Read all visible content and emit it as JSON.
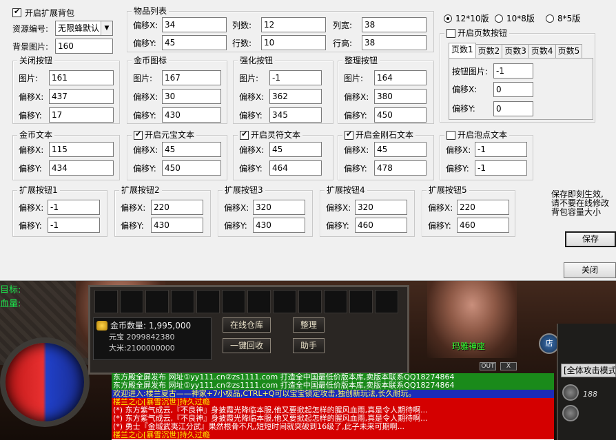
{
  "dialog": {
    "enable_bag": {
      "label": "开启扩展背包",
      "checked": true
    },
    "resource_label": "资源编号:",
    "resource_value": "无限蜂默认",
    "bg_label": "背景图片:",
    "bg_value": "160",
    "items": {
      "title": "物品列表",
      "off_x_label": "偏移X:",
      "off_x": "34",
      "off_y_label": "偏移Y:",
      "off_y": "45",
      "cols_label": "列数:",
      "cols": "12",
      "rows_label": "行数:",
      "rows": "10",
      "colw_label": "列宽:",
      "colw": "38",
      "rowh_label": "行高:",
      "rowh": "38"
    },
    "layouts": [
      {
        "label": "12*10版",
        "selected": true
      },
      {
        "label": "10*8版",
        "selected": false
      },
      {
        "label": "8*5版",
        "selected": false
      }
    ],
    "page_btn": {
      "title": "开启页数按钮",
      "checked": false,
      "tabs": [
        "页数1",
        "页数2",
        "页数3",
        "页数4",
        "页数5"
      ],
      "img_label": "按钮图片:",
      "img": "-1",
      "x_label": "偏移X:",
      "x": "0",
      "y_label": "偏移Y:",
      "y": "0"
    },
    "close_btn": {
      "title": "关闭按钮",
      "img_label": "图片:",
      "img": "161",
      "x_label": "偏移X:",
      "x": "437",
      "y_label": "偏移Y:",
      "y": "17"
    },
    "gold_icon": {
      "title": "金币图标",
      "img_label": "图片:",
      "img": "167",
      "x_label": "偏移X:",
      "x": "30",
      "y_label": "偏移Y:",
      "y": "430"
    },
    "enhance_btn": {
      "title": "强化按钮",
      "img_label": "图片:",
      "img": "-1",
      "x_label": "偏移X:",
      "x": "362",
      "y_label": "偏移Y:",
      "y": "345"
    },
    "sort_btn": {
      "title": "整理按钮",
      "img_label": "图片:",
      "img": "164",
      "x_label": "偏移X:",
      "x": "380",
      "y_label": "偏移Y:",
      "y": "450"
    },
    "gold_text": {
      "title": "金币文本",
      "x_label": "偏移X:",
      "x": "115",
      "y_label": "偏移Y:",
      "y": "434"
    },
    "yuanbao_text": {
      "title": "开启元宝文本",
      "checked": true,
      "x_label": "偏移X:",
      "x": "45",
      "y_label": "偏移Y:",
      "y": "450"
    },
    "lingfu_text": {
      "title": "开启灵符文本",
      "checked": true,
      "x_label": "偏移X:",
      "x": "45",
      "y_label": "偏移Y:",
      "y": "464"
    },
    "diamond_text": {
      "title": "开启金刚石文本",
      "checked": true,
      "x_label": "偏移X:",
      "x": "45",
      "y_label": "偏移Y:",
      "y": "478"
    },
    "bubble_text": {
      "title": "开启泡点文本",
      "checked": false,
      "x_label": "偏移X:",
      "x": "-1",
      "y_label": "偏移Y:",
      "y": "-1"
    },
    "ext_btns": [
      {
        "title": "扩展按钮1",
        "x_label": "偏移X:",
        "x": "-1",
        "y_label": "偏移Y:",
        "y": "-1"
      },
      {
        "title": "扩展按钮2",
        "x_label": "偏移X:",
        "x": "220",
        "y_label": "偏移Y:",
        "y": "430"
      },
      {
        "title": "扩展按钮3",
        "x_label": "偏移X:",
        "x": "320",
        "y_label": "偏移Y:",
        "y": "430"
      },
      {
        "title": "扩展按钮4",
        "x_label": "偏移X:",
        "x": "320",
        "y_label": "偏移Y:",
        "y": "460"
      },
      {
        "title": "扩展按钮5",
        "x_label": "偏移X:",
        "x": "220",
        "y_label": "偏移Y:",
        "y": "460"
      }
    ],
    "note_lines": [
      "保存即刻生效,",
      "请不要在线修改",
      "背包容量大小"
    ],
    "save_label": "保存",
    "close_label": "关闭"
  },
  "game": {
    "left_labels": [
      "目标:",
      "血量:"
    ],
    "gold_label": "金币数量:",
    "gold_value": "1,995,000",
    "yuanbao_line": "元宝 2099842380",
    "dami_line": "大米:2100000000",
    "btn_warehouse": "在线仓库",
    "btn_sort": "整理",
    "btn_recycle": "一键回收",
    "btn_helper": "助手",
    "shop_icon": "店",
    "npc_name": "玛雅神座",
    "attack_mode": "[全体攻击模式]",
    "level_badge": "188",
    "out_label": "OUT",
    "x_label": "X",
    "chat": [
      {
        "style": "c-green",
        "text": "东方殿全屏发布 网址①yy111.cn②zs1111.com 打造全中国最低价版本库,卖版本联系QQ18274864"
      },
      {
        "style": "c-green",
        "text": "东方殿全屏发布 网址①yy111.cn②zs1111.com 打造全中国最低价版本库,卖版本联系QQ18274864"
      },
      {
        "style": "c-blue",
        "text": "欢迎进入:楼兰夏古——神家+7小极品,CTRL+Q可以宝宝锁定攻击,独创新玩法,长久耐玩。"
      },
      {
        "style": "c-yellow",
        "text": "楼兰之心[暴雪沉世]持久过瘾"
      },
      {
        "style": "c-red",
        "text": "(*) 东方紫气成云,『不良神』身披霞光降临本服,他又要掀起怎样的腥风血雨,真是令人期待啊..."
      },
      {
        "style": "c-red",
        "text": "(*) 东方紫气成云,『不良神』身披霞光降临本服,他又要掀起怎样的腥风血雨,真是令人期待啊..."
      },
      {
        "style": "c-red",
        "text": "(*) 勇士『金城武夷江分武』果然根骨不凡,短短时间就突破到16级了,此子未来可期啊..."
      },
      {
        "style": "c-yellow",
        "text": "楼兰之心[暴雪沉世]持久过瘾"
      }
    ]
  }
}
